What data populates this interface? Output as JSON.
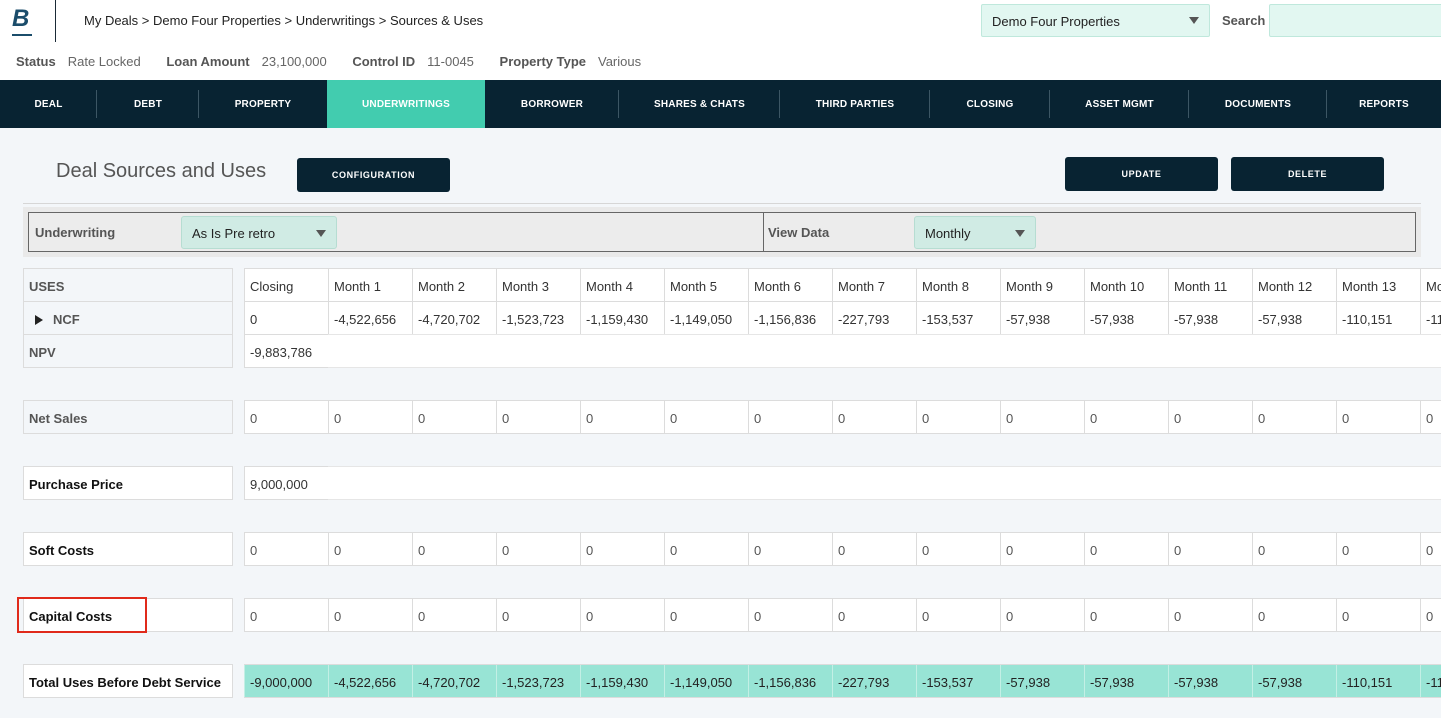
{
  "header": {
    "logo_letter": "B",
    "breadcrumb": "My Deals > Demo Four Properties > Underwritings > Sources & Uses",
    "deal_selector": "Demo Four Properties",
    "search_label": "Search",
    "search_value": "",
    "search_placeholder": ""
  },
  "meta": {
    "status_label": "Status",
    "status_value": "Rate Locked",
    "loan_label": "Loan Amount",
    "loan_value": "23,100,000",
    "control_label": "Control ID",
    "control_value": "11-0045",
    "ptype_label": "Property Type",
    "ptype_value": "Various"
  },
  "nav": {
    "items": [
      {
        "label": "DEAL"
      },
      {
        "label": "DEBT"
      },
      {
        "label": "PROPERTY"
      },
      {
        "label": "UNDERWRITINGS",
        "active": true
      },
      {
        "label": "BORROWER"
      },
      {
        "label": "SHARES & CHATS"
      },
      {
        "label": "THIRD PARTIES"
      },
      {
        "label": "CLOSING"
      },
      {
        "label": "ASSET MGMT"
      },
      {
        "label": "DOCUMENTS"
      },
      {
        "label": "REPORTS"
      }
    ]
  },
  "page": {
    "title": "Deal Sources and Uses",
    "configuration_label": "CONFIGURATION",
    "update_label": "UPDATE",
    "delete_label": "DELETE"
  },
  "filters": {
    "underwriting_label": "Underwriting",
    "underwriting_value": "As Is Pre retro",
    "view_label": "View Data",
    "view_value": "Monthly"
  },
  "table": {
    "section_label": "USES",
    "columns": [
      "Closing",
      "Month 1",
      "Month 2",
      "Month 3",
      "Month 4",
      "Month 5",
      "Month 6",
      "Month 7",
      "Month 8",
      "Month 9",
      "Month 10",
      "Month 11",
      "Month 12",
      "Month 13",
      "Mo"
    ],
    "ncf": {
      "label": "NCF",
      "values": [
        "0",
        "-4,522,656",
        "-4,720,702",
        "-1,523,723",
        "-1,159,430",
        "-1,149,050",
        "-1,156,836",
        "-227,793",
        "-153,537",
        "-57,938",
        "-57,938",
        "-57,938",
        "-57,938",
        "-110,151",
        "-11"
      ]
    },
    "npv": {
      "label": "NPV",
      "value": "-9,883,786"
    },
    "net_sales": {
      "label": "Net Sales",
      "values": [
        "0",
        "0",
        "0",
        "0",
        "0",
        "0",
        "0",
        "0",
        "0",
        "0",
        "0",
        "0",
        "0",
        "0",
        "0"
      ]
    },
    "purchase_price": {
      "label": "Purchase Price",
      "value": "9,000,000"
    },
    "soft_costs": {
      "label": "Soft Costs",
      "values": [
        "0",
        "0",
        "0",
        "0",
        "0",
        "0",
        "0",
        "0",
        "0",
        "0",
        "0",
        "0",
        "0",
        "0",
        "0"
      ]
    },
    "capital_costs": {
      "label": "Capital Costs",
      "values": [
        "0",
        "0",
        "0",
        "0",
        "0",
        "0",
        "0",
        "0",
        "0",
        "0",
        "0",
        "0",
        "0",
        "0",
        "0"
      ]
    },
    "total": {
      "label": "Total Uses Before Debt Service",
      "values": [
        "-9,000,000",
        "-4,522,656",
        "-4,720,702",
        "-1,523,723",
        "-1,159,430",
        "-1,149,050",
        "-1,156,836",
        "-227,793",
        "-153,537",
        "-57,938",
        "-57,938",
        "-57,938",
        "-57,938",
        "-110,151",
        "-11"
      ]
    }
  },
  "colors": {
    "nav_bg": "#082332",
    "nav_active": "#42ccaf",
    "total_row": "#98e4d5",
    "highlight": "#e02a1b"
  }
}
